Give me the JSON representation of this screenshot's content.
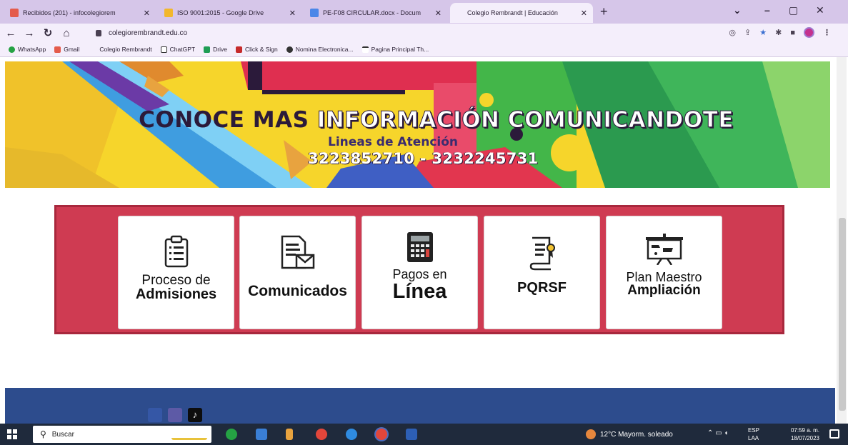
{
  "browser": {
    "tabs": [
      {
        "title": "Recibidos (201) - infocolegiorem",
        "active": false
      },
      {
        "title": "ISO 9001:2015 - Google Drive",
        "active": false
      },
      {
        "title": "PE-F08 CIRCULAR.docx - Docum",
        "active": false
      },
      {
        "title": "Colegio Rembrandt | Educación",
        "active": true
      }
    ],
    "new_tab": "+",
    "url": "colegiorembrandt.edu.co",
    "bookmarks": [
      "WhatsApp",
      "Gmail",
      "Colegio Rembrandt",
      "ChatGPT",
      "Drive",
      "Click & Sign",
      "Nomina Electronica...",
      "Pagina Principal Th..."
    ]
  },
  "banner": {
    "title_part1": "CONOCE MAS ",
    "title_part2": "INFORMACIÓN COMUNICANDOTE",
    "subtitle": "Lineas de Atención",
    "phones": "3223852710 - 3232245731"
  },
  "cards": [
    {
      "line1": "Proceso de",
      "line2": "Admisiones",
      "icon": "clipboard-icon"
    },
    {
      "line1": "",
      "line2": "Comunicados",
      "icon": "document-mail-icon"
    },
    {
      "line1": "Pagos en",
      "line2": "Línea",
      "icon": "calculator-icon"
    },
    {
      "line1": "",
      "line2": "PQRSF",
      "icon": "scroll-certificate-icon"
    },
    {
      "line1": "Plan Maestro",
      "line2": "Ampliación",
      "icon": "presentation-board-icon"
    }
  ],
  "taskbar": {
    "search_placeholder": "Buscar",
    "weather": "12°C  Mayorm. soleado",
    "lang_top": "ESP",
    "lang_bottom": "LAA",
    "time": "07:59 a. m.",
    "date": "18/07/2023"
  },
  "colors": {
    "panel_red": "#cf3b52",
    "footer_blue": "#2d4c8d",
    "tab_bar": "#d6c6e9"
  }
}
